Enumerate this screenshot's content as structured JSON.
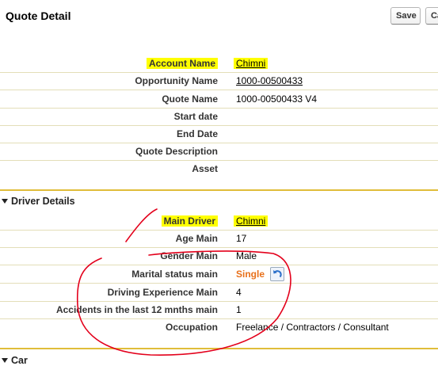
{
  "page": {
    "title": "Quote Detail"
  },
  "toolbar": {
    "save_label": "Save",
    "cancel_label": "Ca"
  },
  "quote_fields": [
    {
      "label": "Account Name",
      "value": "Chimni",
      "link": true,
      "highlight": true
    },
    {
      "label": "Opportunity Name",
      "value": "1000-00500433",
      "link": true
    },
    {
      "label": "Quote Name",
      "value": "1000-00500433 V4"
    },
    {
      "label": "Start date",
      "value": ""
    },
    {
      "label": "End Date",
      "value": ""
    },
    {
      "label": "Quote Description",
      "value": ""
    },
    {
      "label": "Asset",
      "value": ""
    }
  ],
  "driver_section": {
    "title": "Driver Details",
    "fields": [
      {
        "label": "Main Driver",
        "value": "Chimni",
        "link": true,
        "highlight": true
      },
      {
        "label": "Age Main",
        "value": "17"
      },
      {
        "label": "Gender Main",
        "value": "Male"
      },
      {
        "label": "Marital status main",
        "value": "Single"
      },
      {
        "label": "Driving Experience Main",
        "value": "4"
      },
      {
        "label": "Accidents in the last 12 mnths main",
        "value": "1"
      },
      {
        "label": "Occupation",
        "value": "Freelance / Contractors / Consultant"
      }
    ]
  },
  "car_section": {
    "title": "Car"
  },
  "colors": {
    "highlight": "#ffff00",
    "section_rule": "#e0bd3a",
    "annotation": "#e3001b",
    "single_value": "#e8701a"
  }
}
